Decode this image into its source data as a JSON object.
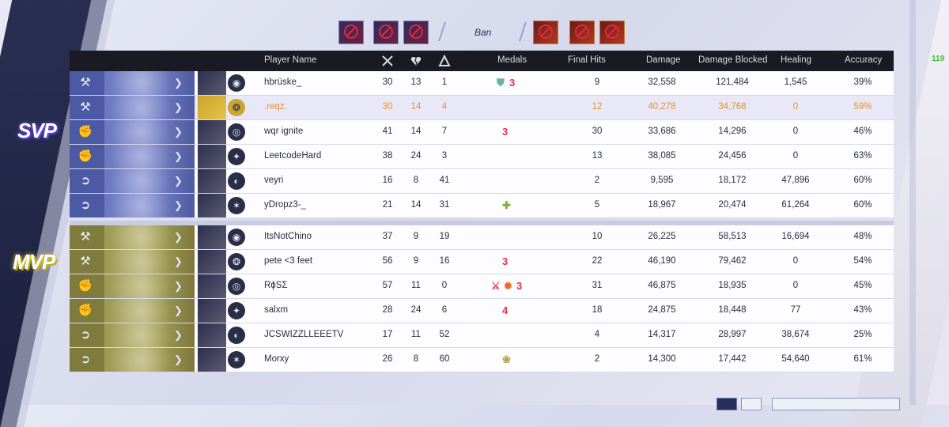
{
  "ban": {
    "label": "Ban",
    "left_icons": [
      "hero-ban-1",
      "hero-ban-2",
      "hero-ban-3"
    ],
    "right_icons": [
      "hero-ban-4",
      "hero-ban-5",
      "hero-ban-6"
    ]
  },
  "header": {
    "player_name": "Player Name",
    "kills_icon": "crossed-swords-icon",
    "deaths_icon": "broken-heart-icon",
    "assists_icon": "assist-icon",
    "medals": "Medals",
    "final_hits": "Final Hits",
    "damage": "Damage",
    "damage_blocked": "Damage Blocked",
    "healing": "Healing",
    "accuracy": "Accuracy"
  },
  "badges": {
    "svp": "SVP",
    "mvp": "MVP"
  },
  "corner_value": "119",
  "team_a": [
    {
      "name": "hbrüske_",
      "kills": "30",
      "deaths": "13",
      "assists": "1",
      "medals": [
        "shield",
        "3"
      ],
      "final_hits": "9",
      "damage": "32,558",
      "blocked": "121,484",
      "healing": "1,545",
      "accuracy": "39%",
      "role": "vanguard"
    },
    {
      "name": ".reqz.",
      "kills": "30",
      "deaths": "14",
      "assists": "4",
      "medals": [],
      "final_hits": "12",
      "damage": "40,278",
      "blocked": "34,768",
      "healing": "0",
      "accuracy": "59%",
      "role": "vanguard"
    },
    {
      "name": "wqr ignite",
      "kills": "41",
      "deaths": "14",
      "assists": "7",
      "medals": [
        "3"
      ],
      "final_hits": "30",
      "damage": "33,686",
      "blocked": "14,296",
      "healing": "0",
      "accuracy": "46%",
      "role": "duelist"
    },
    {
      "name": "LeetcodeHard",
      "kills": "38",
      "deaths": "24",
      "assists": "3",
      "medals": [],
      "final_hits": "13",
      "damage": "38,085",
      "blocked": "24,456",
      "healing": "0",
      "accuracy": "63%",
      "role": "duelist"
    },
    {
      "name": "veyri",
      "kills": "16",
      "deaths": "8",
      "assists": "41",
      "medals": [],
      "final_hits": "2",
      "damage": "9,595",
      "blocked": "18,172",
      "healing": "47,896",
      "accuracy": "60%",
      "role": "strategist"
    },
    {
      "name": "yDropz3-_",
      "kills": "21",
      "deaths": "14",
      "assists": "31",
      "medals": [
        "plus"
      ],
      "final_hits": "5",
      "damage": "18,967",
      "blocked": "20,474",
      "healing": "61,264",
      "accuracy": "60%",
      "role": "strategist"
    }
  ],
  "team_b": [
    {
      "name": "ItsNotChino",
      "kills": "37",
      "deaths": "9",
      "assists": "19",
      "medals": [],
      "final_hits": "10",
      "damage": "26,225",
      "blocked": "58,513",
      "healing": "16,694",
      "accuracy": "48%",
      "role": "vanguard"
    },
    {
      "name": "pete <3 feet",
      "kills": "56",
      "deaths": "9",
      "assists": "16",
      "medals": [
        "3"
      ],
      "final_hits": "22",
      "damage": "46,190",
      "blocked": "79,462",
      "healing": "0",
      "accuracy": "54%",
      "role": "vanguard"
    },
    {
      "name": "RϕSΣ",
      "kills": "57",
      "deaths": "11",
      "assists": "0",
      "medals": [
        "swords",
        "fire",
        "3"
      ],
      "final_hits": "31",
      "damage": "46,875",
      "blocked": "18,935",
      "healing": "0",
      "accuracy": "45%",
      "role": "duelist"
    },
    {
      "name": "salxm",
      "kills": "28",
      "deaths": "24",
      "assists": "6",
      "medals": [
        "4"
      ],
      "final_hits": "18",
      "damage": "24,875",
      "blocked": "18,448",
      "healing": "77",
      "accuracy": "43%",
      "role": "duelist"
    },
    {
      "name": "JCSWIZZLLEEETV",
      "kills": "17",
      "deaths": "11",
      "assists": "52",
      "medals": [],
      "final_hits": "4",
      "damage": "14,317",
      "blocked": "28,997",
      "healing": "38,674",
      "accuracy": "25%",
      "role": "strategist"
    },
    {
      "name": "Morxy",
      "kills": "26",
      "deaths": "8",
      "assists": "60",
      "medals": [
        "gold"
      ],
      "final_hits": "2",
      "damage": "14,300",
      "blocked": "17,442",
      "healing": "54,640",
      "accuracy": "61%",
      "role": "strategist"
    }
  ],
  "colors": {
    "team_a": "#4c5aa4",
    "team_b": "#7f7b3c",
    "highlight_text": "#e8902a",
    "medal_red": "#e0344a"
  }
}
